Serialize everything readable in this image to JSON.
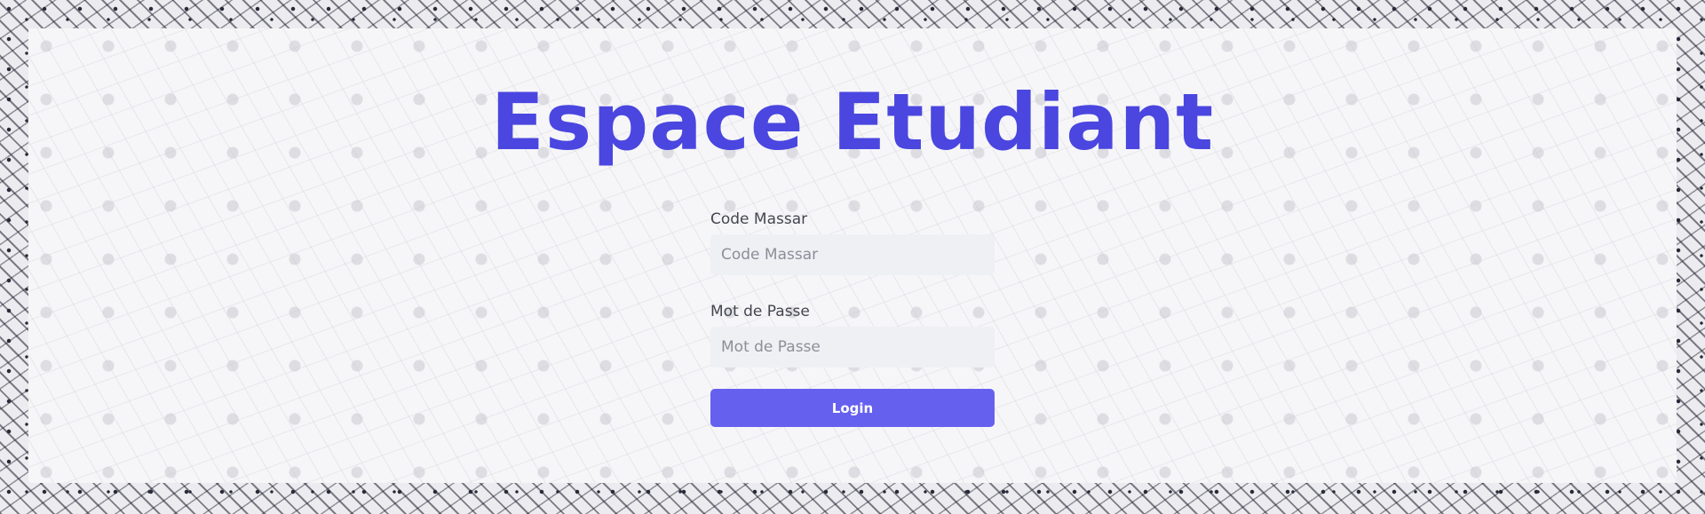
{
  "page": {
    "title": "Espace Etudiant"
  },
  "form": {
    "code_massar": {
      "label": "Code Massar",
      "placeholder": "Code Massar",
      "value": ""
    },
    "mot_de_passe": {
      "label": "Mot de Passe",
      "placeholder": "Mot de Passe",
      "value": ""
    },
    "login_label": "Login"
  },
  "colors": {
    "title": "#4a46df",
    "button": "#6660ef",
    "input_bg": "#eef0f4",
    "label": "#444650"
  }
}
